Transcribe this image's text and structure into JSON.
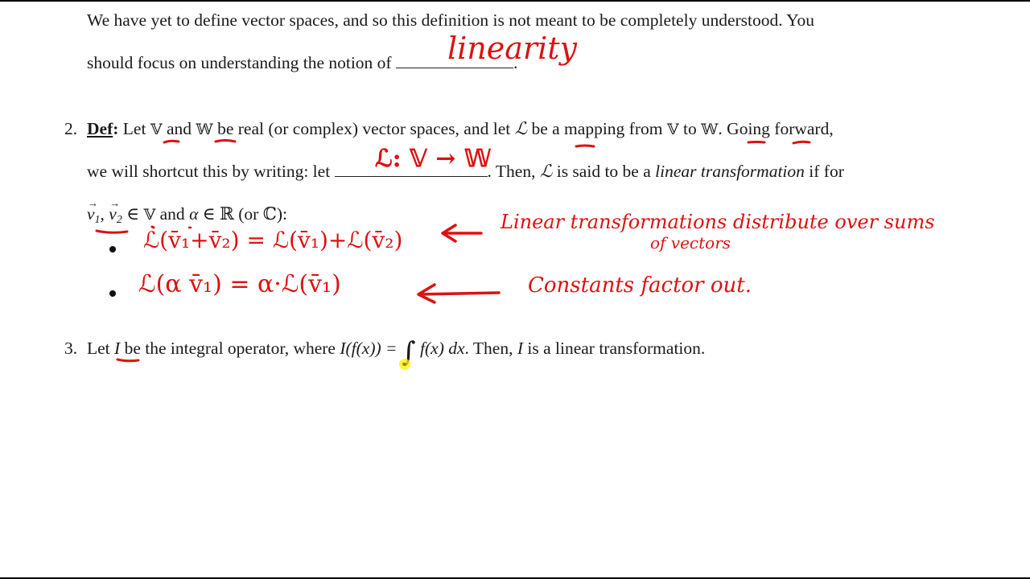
{
  "page": {
    "item1": {
      "line1": "We have yet to define vector spaces, and so this definition is not meant to be completely understood.  You",
      "line2_prefix": "should focus on understanding the notion of ",
      "line2_suffix": ".",
      "handwritten_blank": "linearity"
    },
    "item2": {
      "number": "2.",
      "def_label": "Def",
      "def_colon": ":",
      "line1": {
        "t1": " Let ",
        "V": "𝕍",
        "t2": " and ",
        "W": "𝕎",
        "t3": " be real (or complex) vector spaces, and let ",
        "L": "ℒ",
        "t4": " be a mapping from ",
        "V2": "𝕍",
        "t5": " to ",
        "W2": "𝕎",
        "t6": ".  Going forward,"
      },
      "line2": {
        "prefix": "we will shortcut this by writing: let ",
        "suffix_1": ". Then, ",
        "L": "ℒ",
        "suffix_2": " is said to be a ",
        "emph": "linear transformation",
        "suffix_3": " if for"
      },
      "handwritten_blank": "ℒ: 𝕍 → 𝕎",
      "line3": {
        "v1": "v",
        "v1_sub": "1",
        "comma": ", ",
        "v2": "v",
        "v2_sub": "2",
        "t1": " ∈ ",
        "V": "𝕍",
        "t2": " and ",
        "alpha": "α",
        "t3": " ∈ ℝ (or ℂ):"
      },
      "bullets": [
        {
          "handwritten_formula": "ℒ(v̄₁+v̄₂) = ℒ(v̄₁)+ℒ(v̄₂)",
          "handwritten_note": "Linear transformations distribute over sums",
          "handwritten_note_line2": "of vectors"
        },
        {
          "handwritten_formula": "ℒ(α v̄₁) = α·ℒ(v̄₁)",
          "handwritten_note": "Constants factor out."
        }
      ]
    },
    "item3": {
      "number": "3.",
      "t1": "Let ",
      "I": "I",
      "t2": " be the integral operator, where ",
      "formula_lhs": "I(f(x)) = ",
      "integral": "∫",
      "formula_rhs": " f(x) dx",
      "t3": ".  Then, ",
      "I2": "I",
      "t4": " is a linear transformation."
    }
  },
  "annotation_color": "#dd1111",
  "cursor_color": "#ffee00"
}
